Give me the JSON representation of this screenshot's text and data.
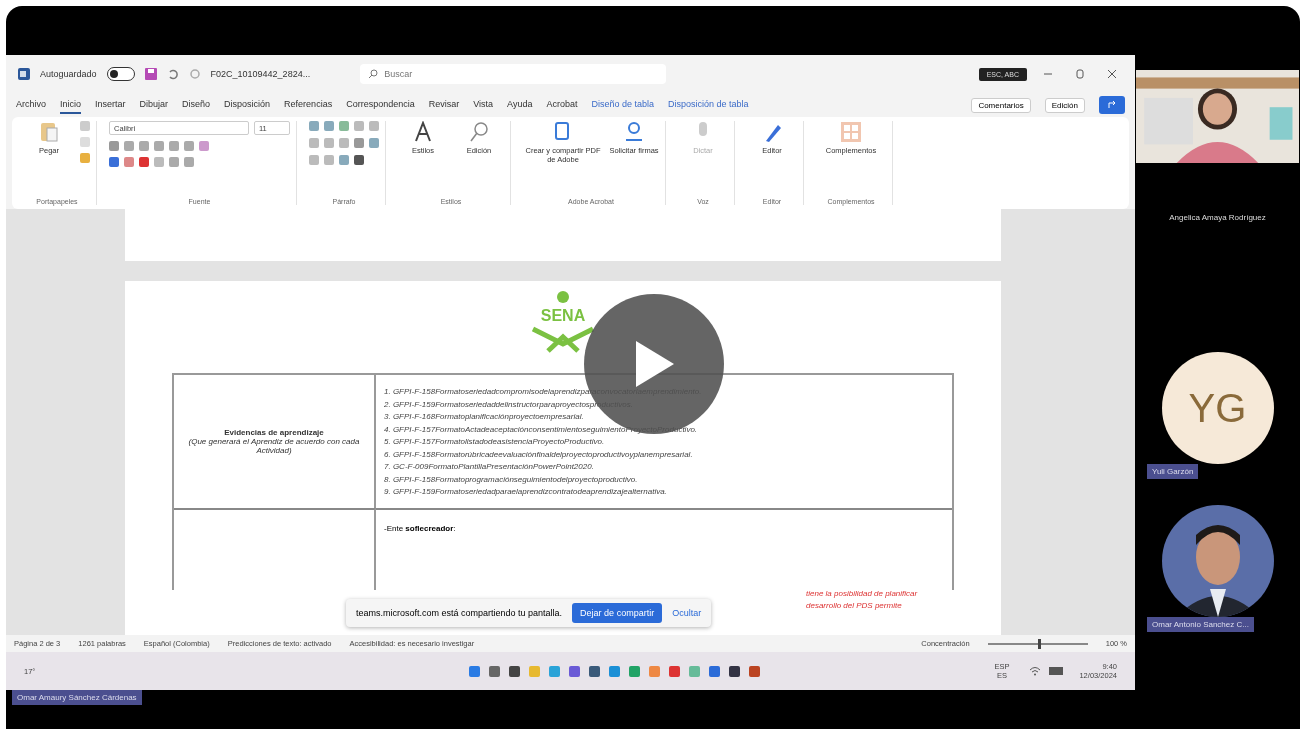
{
  "word": {
    "title_bar": {
      "autosave_label": "Autoguardado",
      "autosave_on": false,
      "file_name": "F02C_10109442_2824...",
      "search_placeholder": "Buscar",
      "account": "ESC, ABC"
    },
    "tabs": [
      {
        "label": "Archivo",
        "selected": false,
        "kind": "main"
      },
      {
        "label": "Inicio",
        "selected": true,
        "kind": "main"
      },
      {
        "label": "Insertar",
        "selected": false,
        "kind": "main"
      },
      {
        "label": "Dibujar",
        "selected": false,
        "kind": "main"
      },
      {
        "label": "Diseño",
        "selected": false,
        "kind": "main"
      },
      {
        "label": "Disposición",
        "selected": false,
        "kind": "main"
      },
      {
        "label": "Referencias",
        "selected": false,
        "kind": "main"
      },
      {
        "label": "Correspondencia",
        "selected": false,
        "kind": "main"
      },
      {
        "label": "Revisar",
        "selected": false,
        "kind": "main"
      },
      {
        "label": "Vista",
        "selected": false,
        "kind": "main"
      },
      {
        "label": "Ayuda",
        "selected": false,
        "kind": "main"
      },
      {
        "label": "Acrobat",
        "selected": false,
        "kind": "main"
      },
      {
        "label": "Diseño de tabla",
        "selected": false,
        "kind": "contextual"
      },
      {
        "label": "Disposición de tabla",
        "selected": false,
        "kind": "contextual"
      }
    ],
    "tab_actions": [
      "Comentarios",
      "Edición"
    ],
    "ribbon": {
      "paste": "Pegar",
      "font_name": "Calibri",
      "font_size": "11",
      "styles": "Estilos",
      "editing": "Edición",
      "pdf_create": "Crear y compartir PDF de Adobe",
      "pdf_sign": "Solicitar firmas",
      "dictate": "Dictar",
      "dictate_disabled": true,
      "editor": "Editor",
      "addins": "Complementos",
      "groups": [
        "Portapapeles",
        "Fuente",
        "Párrafo",
        "Estilos",
        "Adobe Acrobat",
        "Voz",
        "Editor",
        "Complementos"
      ]
    },
    "document": {
      "logo_text": "SENA",
      "evidence_title": "Evidencias de aprendizaje",
      "evidence_note": "(Que generará el Aprendiz de acuerdo con cada Actividad)",
      "evidence_items": [
        "1. GFPI-F-158Formatoseriedadcompromisodelaprendizparaconvocatoriaemprendimiento.",
        "2. GFPI-F-159Formatoseriedaddelinstructorparaproyectosproductivos.",
        "3. GFPI-F-168Formatoplanificaciónproyectoempresarial.",
        "4. GFPI-F-157FormatoActadeaceptaciónconsentimientoseguimientoProyectoProductivo.",
        "5. GFPI-F-157FormatolistadodeasistenciaProyectoProductivo.",
        "6. GFPI-F-158Formatorúbricadeevaluaciónfinaldelproyectoproductivoyplanempresarial.",
        "7. GC-F-009FormatoPlantillaPresentaciónPowerPoint2020.",
        "8. GFPI-F-158Formatoprogramaciónseguimientodelproyectoproductivo.",
        "9. GFPI-F-159Formatoseriedadparaelaprendizcontratodeaprendizajealternativa."
      ],
      "row2_text": "-Ente **soflecreador**:"
    },
    "share_bar": {
      "message": "teams.microsoft.com está compartiendo tu pantalla.",
      "stop": "Dejar de compartir",
      "hide": "Ocultar"
    },
    "red_note": [
      "tiene la posibilidad de planificar",
      "desarrollo del PDS permite"
    ],
    "status_bar": {
      "page": "Página 2 de 3",
      "words": "1261 palabras",
      "language": "Español (Colombia)",
      "predictions": "Predicciones de texto: activado",
      "accessibility": "Accesibilidad: es necesario investigar",
      "focus": "Concentración",
      "zoom": "100 %",
      "zoom_slider": {
        "level": 0.5
      }
    },
    "taskbar": {
      "weather": "17°",
      "lang_top": "ESP",
      "lang_bottom": "ES",
      "time": "9:40",
      "date": "12/03/2024"
    }
  },
  "participants": [
    {
      "name": "Angelica Amaya Rodríguez",
      "kind": "video"
    },
    {
      "name": "Yuli Garzón",
      "kind": "initials",
      "initials": "YG"
    },
    {
      "name": "Omar Antonio Sanchez C..."
    }
  ],
  "presenter": "Omar Amaury Sánchez Cárdenas"
}
